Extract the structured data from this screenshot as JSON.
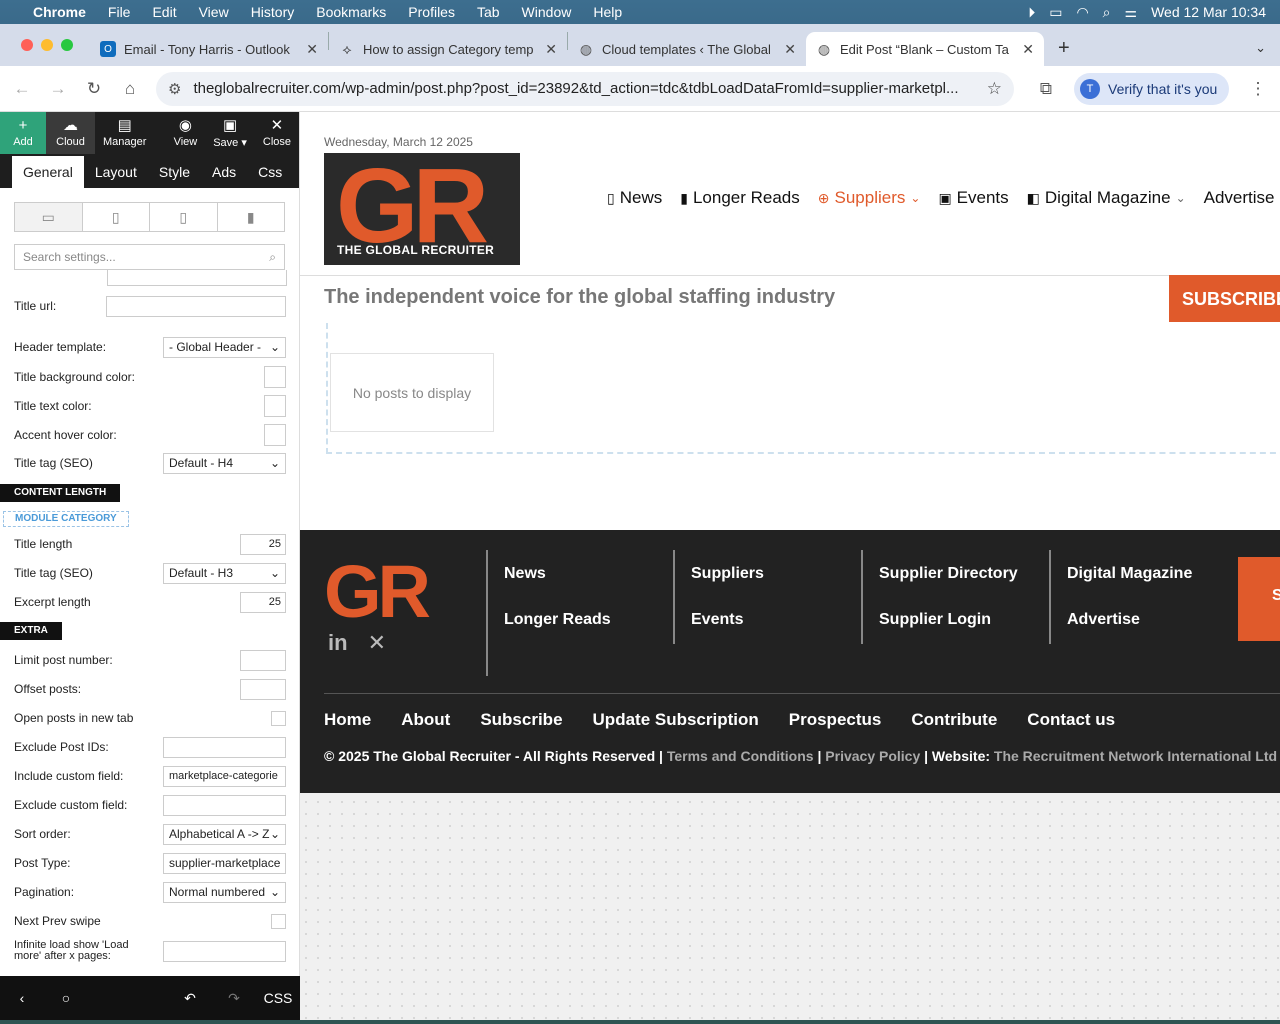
{
  "menubar": {
    "app": "Chrome",
    "items": [
      "File",
      "Edit",
      "View",
      "History",
      "Bookmarks",
      "Profiles",
      "Tab",
      "Window",
      "Help"
    ],
    "datetime": "Wed 12 Mar  10:34"
  },
  "tabs": [
    {
      "title": "Email - Tony Harris - Outlook",
      "icon": "outlook-icon",
      "color": "#0f6cbd"
    },
    {
      "title": "How to assign Category temp",
      "icon": "tagdiv-icon",
      "color": "#333333"
    },
    {
      "title": "Cloud templates ‹ The Global",
      "icon": "globe-icon",
      "color": "#555555"
    },
    {
      "title": "Edit Post “Blank – Custom Ta",
      "icon": "globe-icon",
      "color": "#555555"
    }
  ],
  "address": {
    "url": "theglobalrecruiter.com/wp-admin/post.php?post_id=23892&td_action=tdc&tdbLoadDataFromId=supplier-marketpl...",
    "verify": "Verify that it's you",
    "avatar": "T"
  },
  "builder": {
    "top_buttons": [
      {
        "label": "Add",
        "icon": "+"
      },
      {
        "label": "Cloud",
        "icon": "☁"
      },
      {
        "label": "Manager",
        "icon": "▤"
      },
      {
        "label": "View",
        "icon": "◉"
      },
      {
        "label": "Save ▾",
        "icon": "▣"
      },
      {
        "label": "Close",
        "icon": "✕"
      }
    ],
    "tabs": [
      "General",
      "Layout",
      "Style",
      "Ads",
      "Css"
    ],
    "search_placeholder": "Search settings...",
    "fields": {
      "title_url": "Title url:",
      "header_template": "Header template:",
      "header_template_value": "- Global Header -",
      "title_bg_color": "Title background color:",
      "title_text_color": "Title text color:",
      "accent_hover_color": "Accent hover color:",
      "title_tag_seo": "Title tag (SEO)",
      "title_tag_seo_value": "Default - H4",
      "content_length": "CONTENT LENGTH",
      "module_category": "MODULE CATEGORY",
      "title_length": "Title length",
      "title_length_value": "25",
      "title_tag_seo2": "Title tag (SEO)",
      "title_tag_seo2_value": "Default - H3",
      "excerpt_length": "Excerpt length",
      "excerpt_length_value": "25",
      "extra": "EXTRA",
      "limit_post_number": "Limit post number:",
      "offset_posts": "Offset posts:",
      "open_new_tab": "Open posts in new tab",
      "exclude_post_ids": "Exclude Post IDs:",
      "include_custom_field": "Include custom field:",
      "include_custom_field_value": "marketplace-categorie",
      "exclude_custom_field": "Exclude custom field:",
      "sort_order": "Sort order:",
      "sort_order_value": "Alphabetical A -> Z",
      "post_type": "Post Type:",
      "post_type_value": "supplier-marketplace",
      "pagination": "Pagination:",
      "pagination_value": "Normal numbered",
      "next_prev_swipe": "Next Prev swipe",
      "infinite_load": "Infinite load show 'Load more' after x pages:"
    },
    "bottom": {
      "back": "‹",
      "home": "○",
      "undo": "↶",
      "redo": "↷",
      "css": "CSS"
    }
  },
  "site": {
    "date": "Wednesday, March 12 2025",
    "logo_text": "GR",
    "logo_tagline": "THE GLOBAL RECRUITER",
    "nav": [
      {
        "label": "News",
        "icon": "document-icon"
      },
      {
        "label": "Longer Reads",
        "icon": "document-icon"
      },
      {
        "label": "Suppliers",
        "icon": "globe-icon",
        "active": true,
        "dropdown": true
      },
      {
        "label": "Events",
        "icon": "calendar-icon"
      },
      {
        "label": "Digital Magazine",
        "icon": "book-icon",
        "dropdown": true
      },
      {
        "label": "Advertise",
        "icon": ""
      }
    ],
    "tagline": "The independent voice for the global staffing industry",
    "subscribe": "SUBSCRIBE",
    "no_posts": "No posts to display",
    "footer": {
      "col1": [
        "News",
        "Longer Reads"
      ],
      "col2": [
        "Suppliers",
        "Events"
      ],
      "col3": [
        "Supplier Directory",
        "Supplier Login"
      ],
      "col4": [
        "Digital Magazine",
        "Advertise"
      ],
      "subscribe_short": "S",
      "bottom_nav": [
        "Home",
        "About",
        "Subscribe",
        "Update Subscription",
        "Prospectus",
        "Contribute",
        "Contact us"
      ],
      "copyright": "© 2025 The Global Recruiter - All Rights Reserved | ",
      "terms": "Terms and Conditions",
      "sep": " | ",
      "privacy": "Privacy Policy",
      "website_label": " | Website: ",
      "website": "The Recruitment Network International Ltd"
    },
    "accent": "#e05a2b"
  }
}
